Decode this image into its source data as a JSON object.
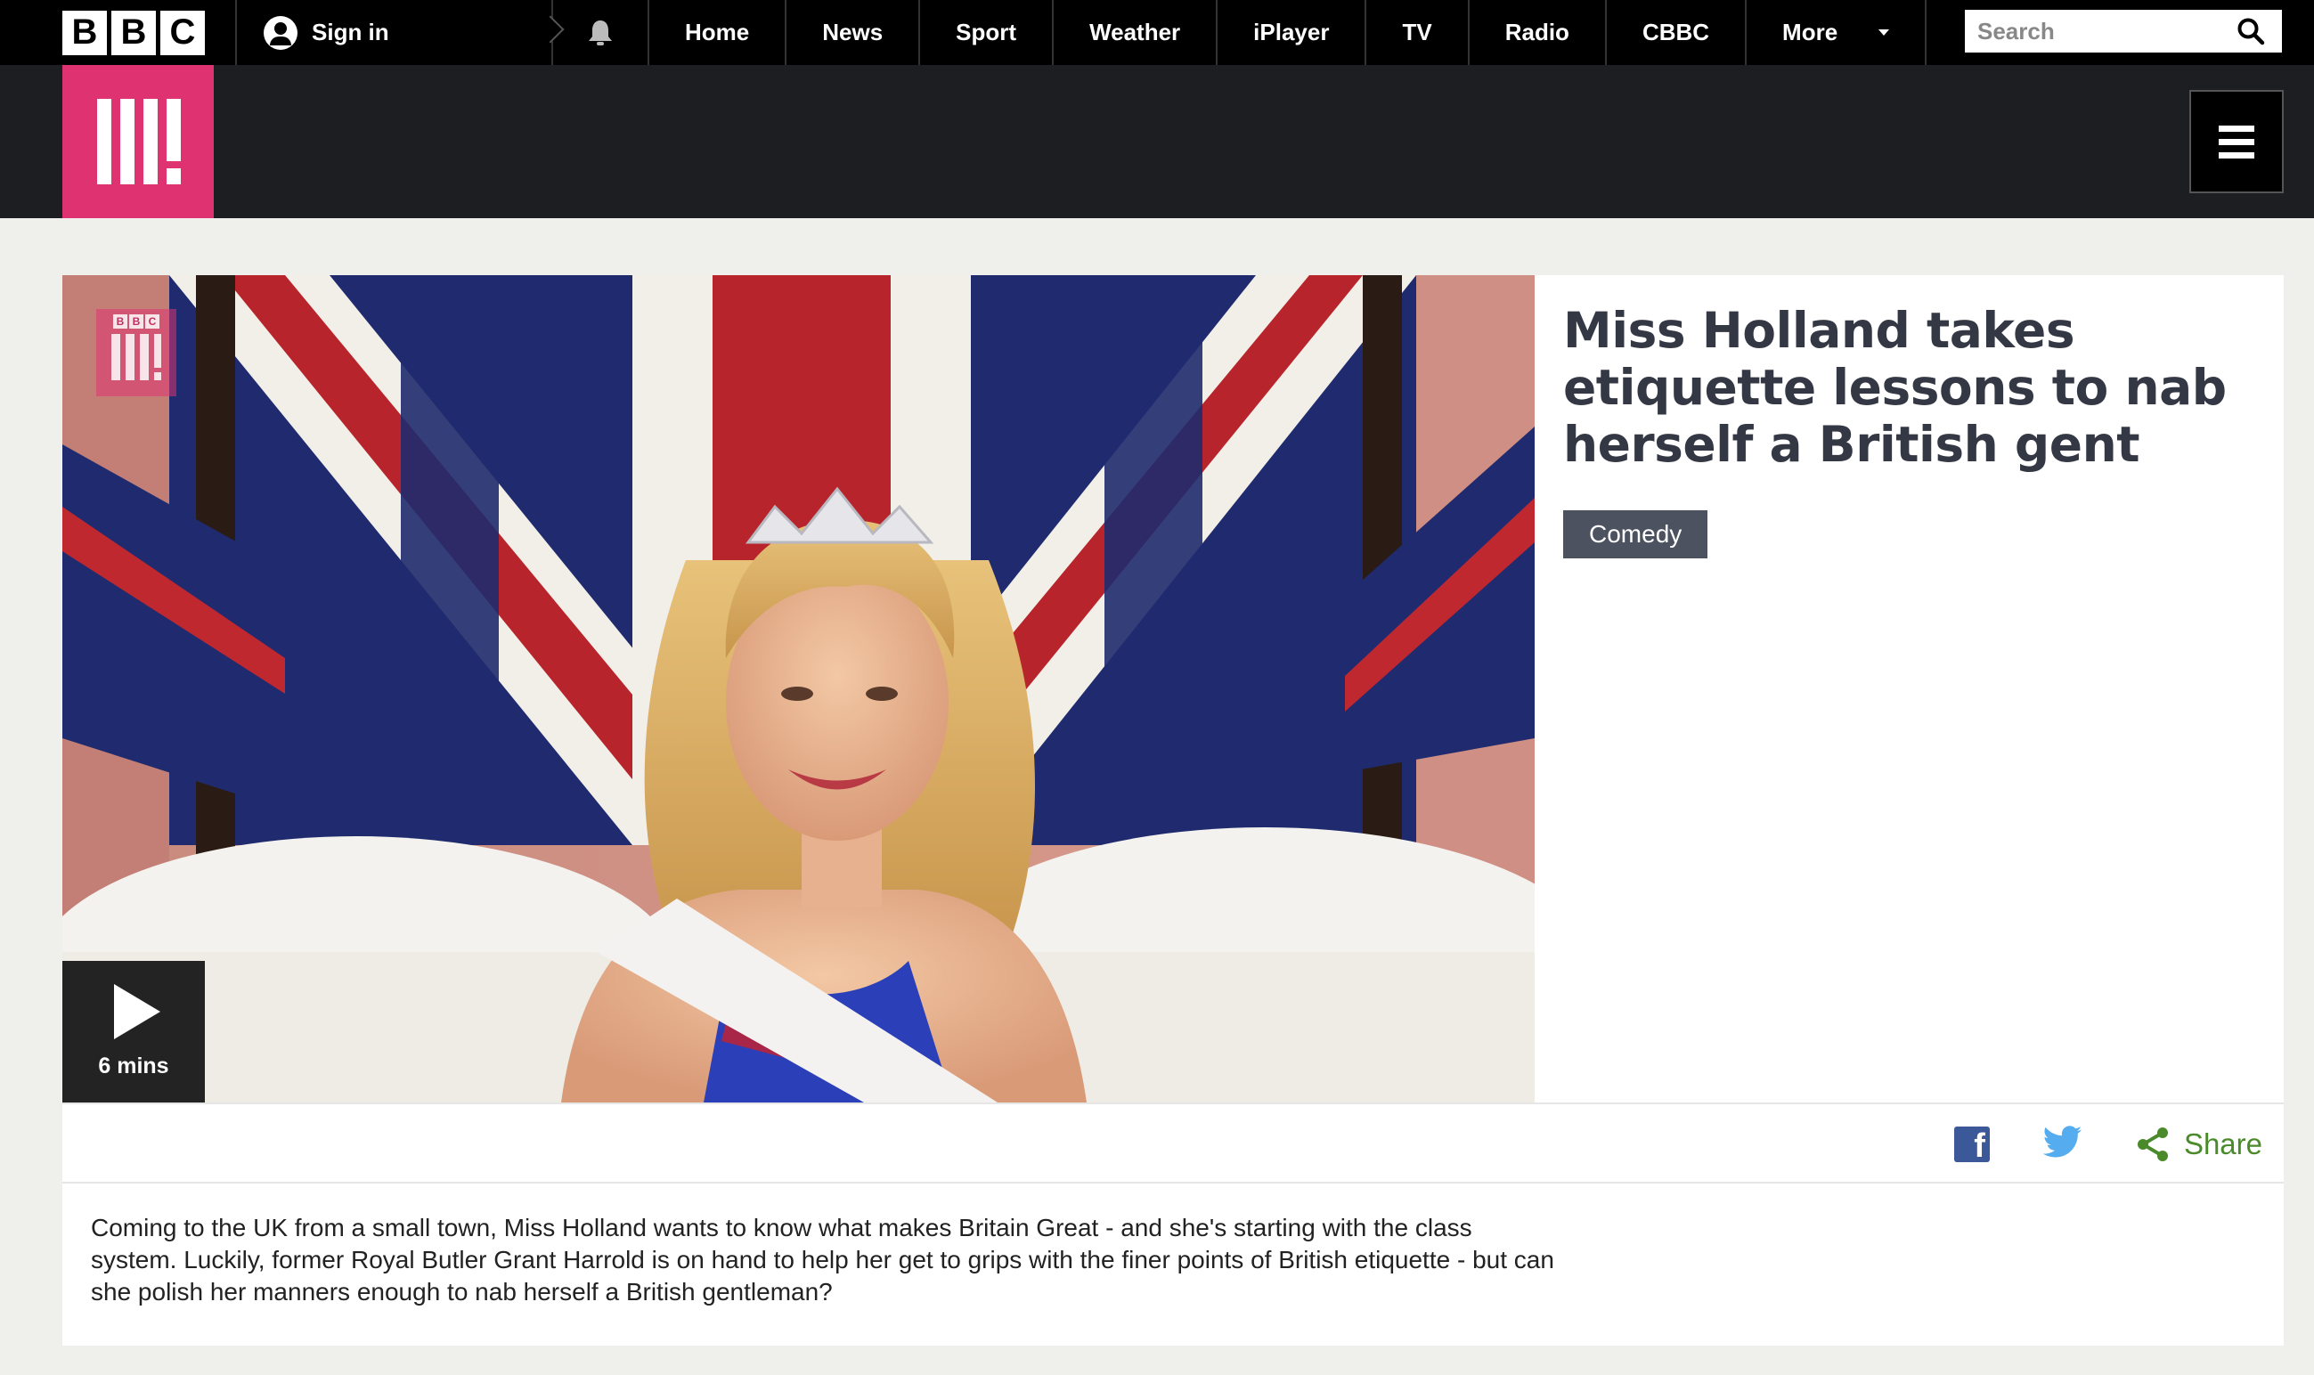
{
  "global_nav": {
    "logo_letters": [
      "B",
      "B",
      "C"
    ],
    "sign_in_label": "Sign in",
    "items": [
      "Home",
      "News",
      "Sport",
      "Weather",
      "iPlayer",
      "TV",
      "Radio",
      "CBBC"
    ],
    "more_label": "More",
    "search_placeholder": "Search"
  },
  "masthead": {
    "brand": "BBC Three",
    "brand_color": "#df3371"
  },
  "article": {
    "title": "Miss Holland takes etiquette lessons to nab herself a British gent",
    "tag": "Comedy",
    "video": {
      "duration": "6 mins",
      "watermark_letters": [
        "B",
        "B",
        "C"
      ]
    },
    "share": {
      "facebook_icon": "facebook-icon",
      "twitter_icon": "twitter-icon",
      "share_label": "Share"
    },
    "description": "Coming to the UK from a small town, Miss Holland wants to know what makes Britain Great - and she's starting with the class system. Luckily, former Royal Butler Grant Harrold is on hand to help her get to grips with the finer points of British etiquette - but can she polish her manners enough to nab herself a British gentleman?"
  },
  "colors": {
    "nav_bg": "#000000",
    "masthead_bg": "#1d1e22",
    "page_bg": "#efefec",
    "tag_bg": "#4c5260",
    "share_green": "#4b8a2a",
    "facebook_blue": "#3b5998",
    "twitter_blue": "#55acee"
  }
}
